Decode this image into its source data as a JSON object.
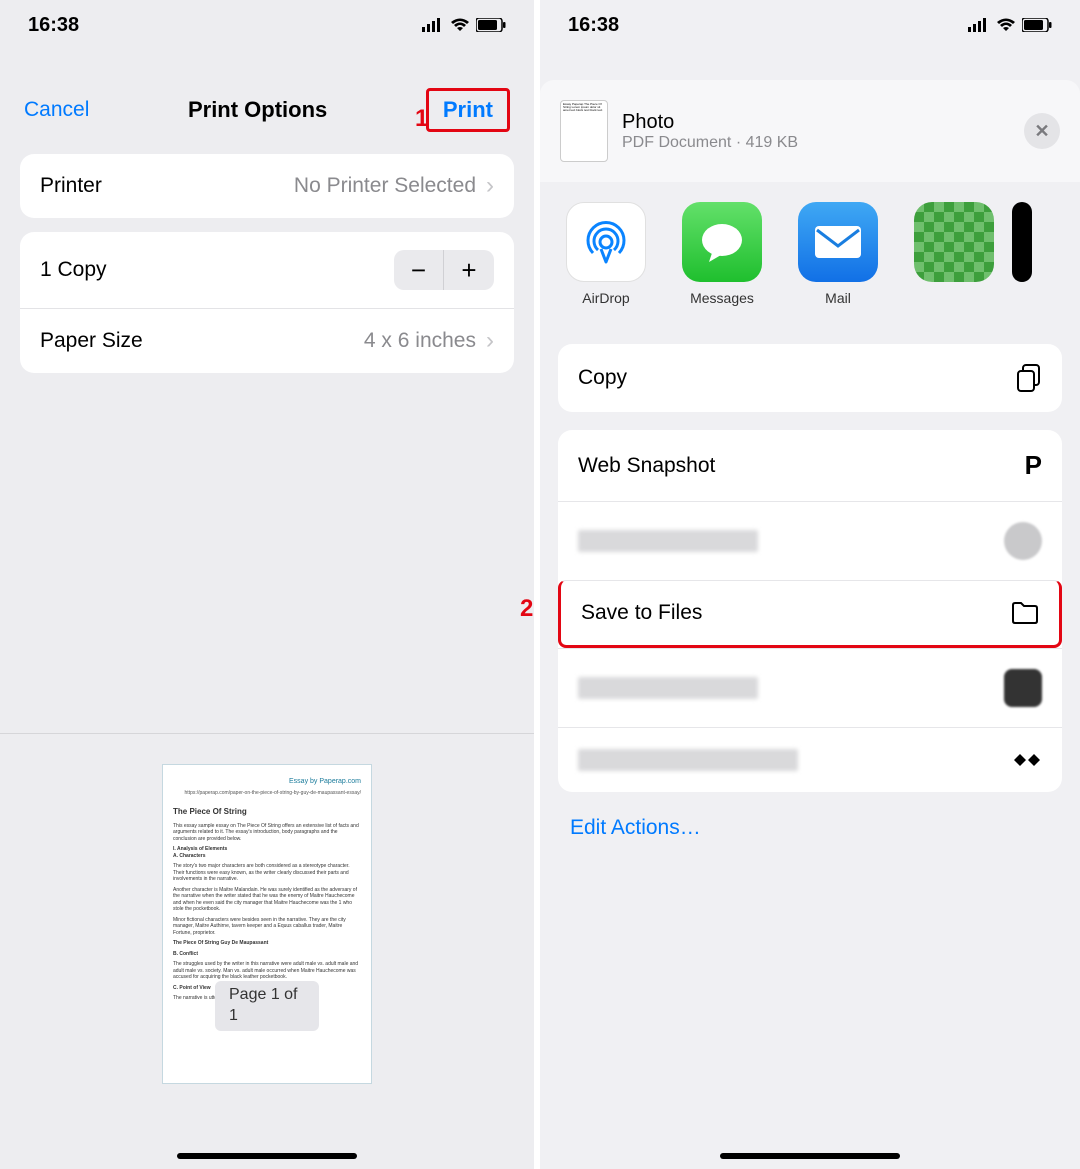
{
  "status": {
    "time": "16:38"
  },
  "print_screen": {
    "cancel": "Cancel",
    "title": "Print Options",
    "print": "Print",
    "annotation1": "1",
    "printer_label": "Printer",
    "printer_value": "No Printer Selected",
    "copies_label": "1 Copy",
    "paper_label": "Paper Size",
    "paper_value": "4 x 6 inches",
    "preview": {
      "brand": "Essay by Paperap.com",
      "url": "https://paperap.com/paper-on-the-piece-of-string-by-guy-de-maupassant-essay/",
      "title": "The Piece Of String",
      "page_badge": "Page 1 of 1"
    }
  },
  "share_screen": {
    "annotation2": "2",
    "header": {
      "title": "Photo",
      "subtitle": "PDF Document · 419 KB"
    },
    "apps": {
      "airdrop": "AirDrop",
      "messages": "Messages",
      "mail": "Mail",
      "hidden": ""
    },
    "actions": {
      "copy": "Copy",
      "web_snapshot": "Web Snapshot",
      "save_files": "Save to Files",
      "edit": "Edit Actions…"
    }
  }
}
